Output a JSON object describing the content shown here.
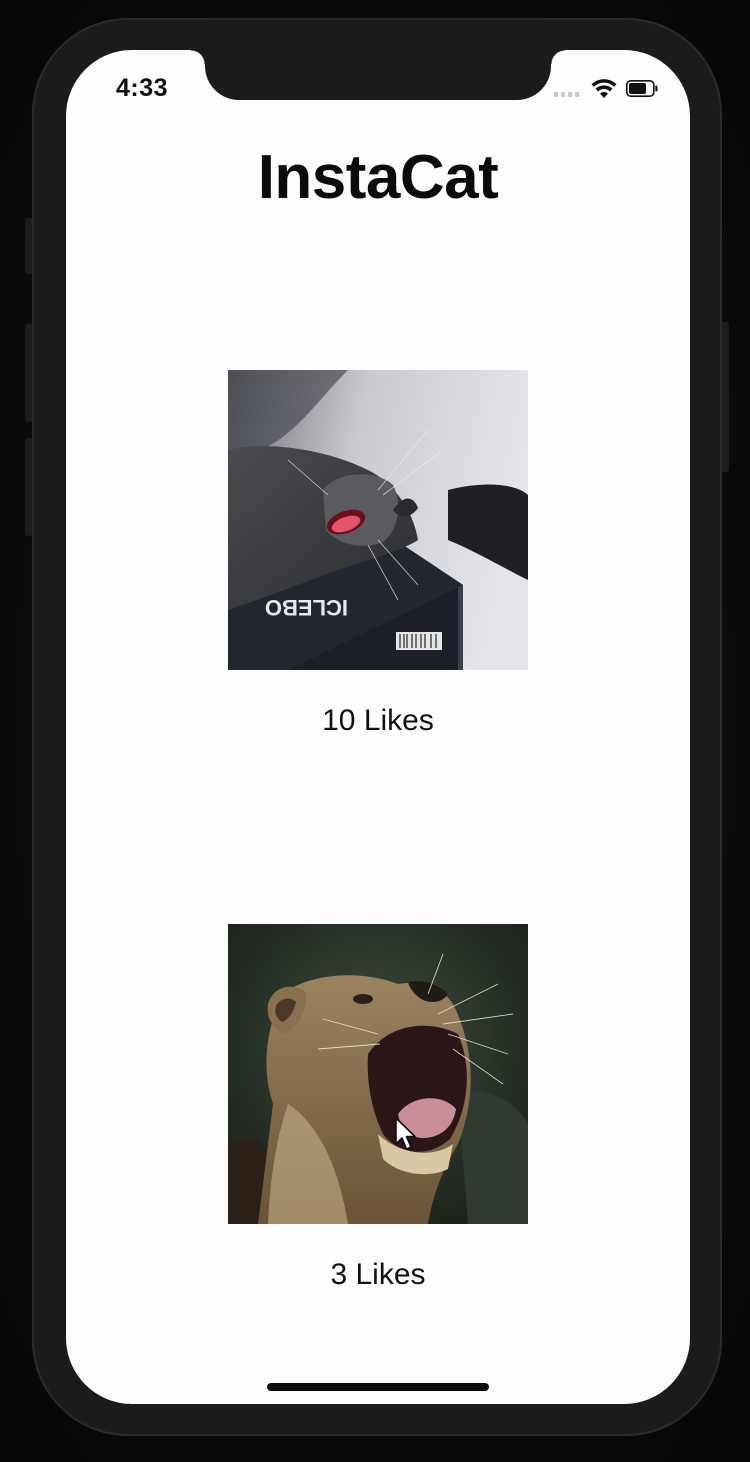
{
  "status_bar": {
    "time": "4:33"
  },
  "app": {
    "title": "InstaCat"
  },
  "feed": {
    "posts": [
      {
        "image_icon": "cat-yawning-on-box-photo",
        "likes_label": "10 Likes",
        "box_text": "ICLEBO"
      },
      {
        "image_icon": "lioness-roaring-photo",
        "likes_label": "3 Likes"
      }
    ]
  },
  "colors": {
    "screen_bg": "#fdfdfd",
    "frame": "#1b1b1d",
    "text": "#111111"
  }
}
